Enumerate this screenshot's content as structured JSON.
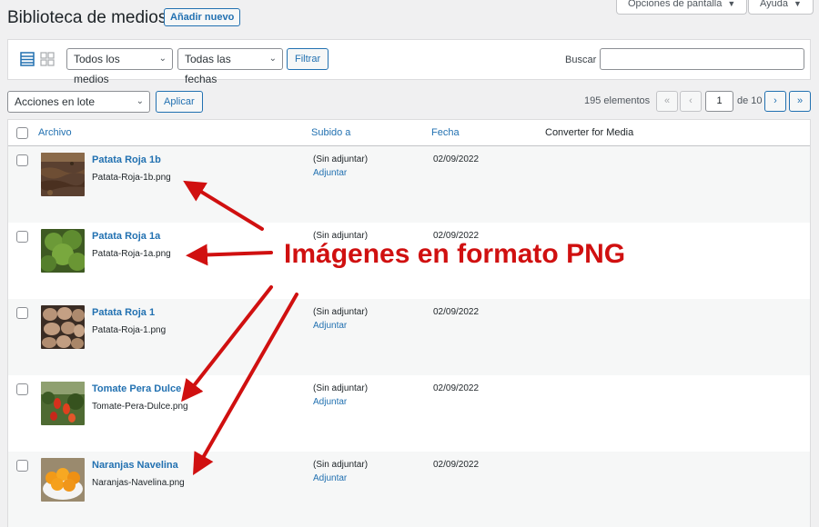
{
  "header": {
    "title": "Biblioteca de medios",
    "add_new": "Añadir nuevo",
    "screen_options": "Opciones de pantalla",
    "help": "Ayuda"
  },
  "filters": {
    "media_type": "Todos los medios",
    "dates": "Todas las fechas",
    "filter_button": "Filtrar",
    "search_label": "Buscar",
    "search_value": ""
  },
  "bulk": {
    "actions": "Acciones en lote",
    "apply": "Aplicar"
  },
  "pagination": {
    "count": "195 elementos",
    "first": "«",
    "prev": "‹",
    "current_page": "1",
    "of_total": "de 10",
    "next": "›",
    "last": "»"
  },
  "table": {
    "columns": {
      "file": "Archivo",
      "uploaded_to": "Subido a",
      "date": "Fecha",
      "converter": "Converter for Media"
    },
    "rows": [
      {
        "title": "Patata Roja 1b",
        "filename": "Patata-Roja-1b.png",
        "attached": "(Sin adjuntar)",
        "attach_link": "Adjuntar",
        "date": "02/09/2022",
        "thumb": "soil-field-image"
      },
      {
        "title": "Patata Roja 1a",
        "filename": "Patata-Roja-1a.png",
        "attached": "(Sin adjuntar)",
        "attach_link": "Adjuntar",
        "date": "02/09/2022",
        "thumb": "potato-plant-image"
      },
      {
        "title": "Patata Roja 1",
        "filename": "Patata-Roja-1.png",
        "attached": "(Sin adjuntar)",
        "attach_link": "Adjuntar",
        "date": "02/09/2022",
        "thumb": "potatoes-image"
      },
      {
        "title": "Tomate Pera Dulce",
        "filename": "Tomate-Pera-Dulce.png",
        "attached": "(Sin adjuntar)",
        "attach_link": "Adjuntar",
        "date": "02/09/2022",
        "thumb": "tomato-plant-image"
      },
      {
        "title": "Naranjas Navelina",
        "filename": "Naranjas-Navelina.png",
        "attached": "(Sin adjuntar)",
        "attach_link": "Adjuntar",
        "date": "02/09/2022",
        "thumb": "oranges-bowl-image"
      }
    ]
  },
  "annotation": {
    "text": "Imágenes en formato PNG",
    "color": "#d01010"
  },
  "colors": {
    "link": "#2271b1",
    "background": "#f0f0f1"
  }
}
